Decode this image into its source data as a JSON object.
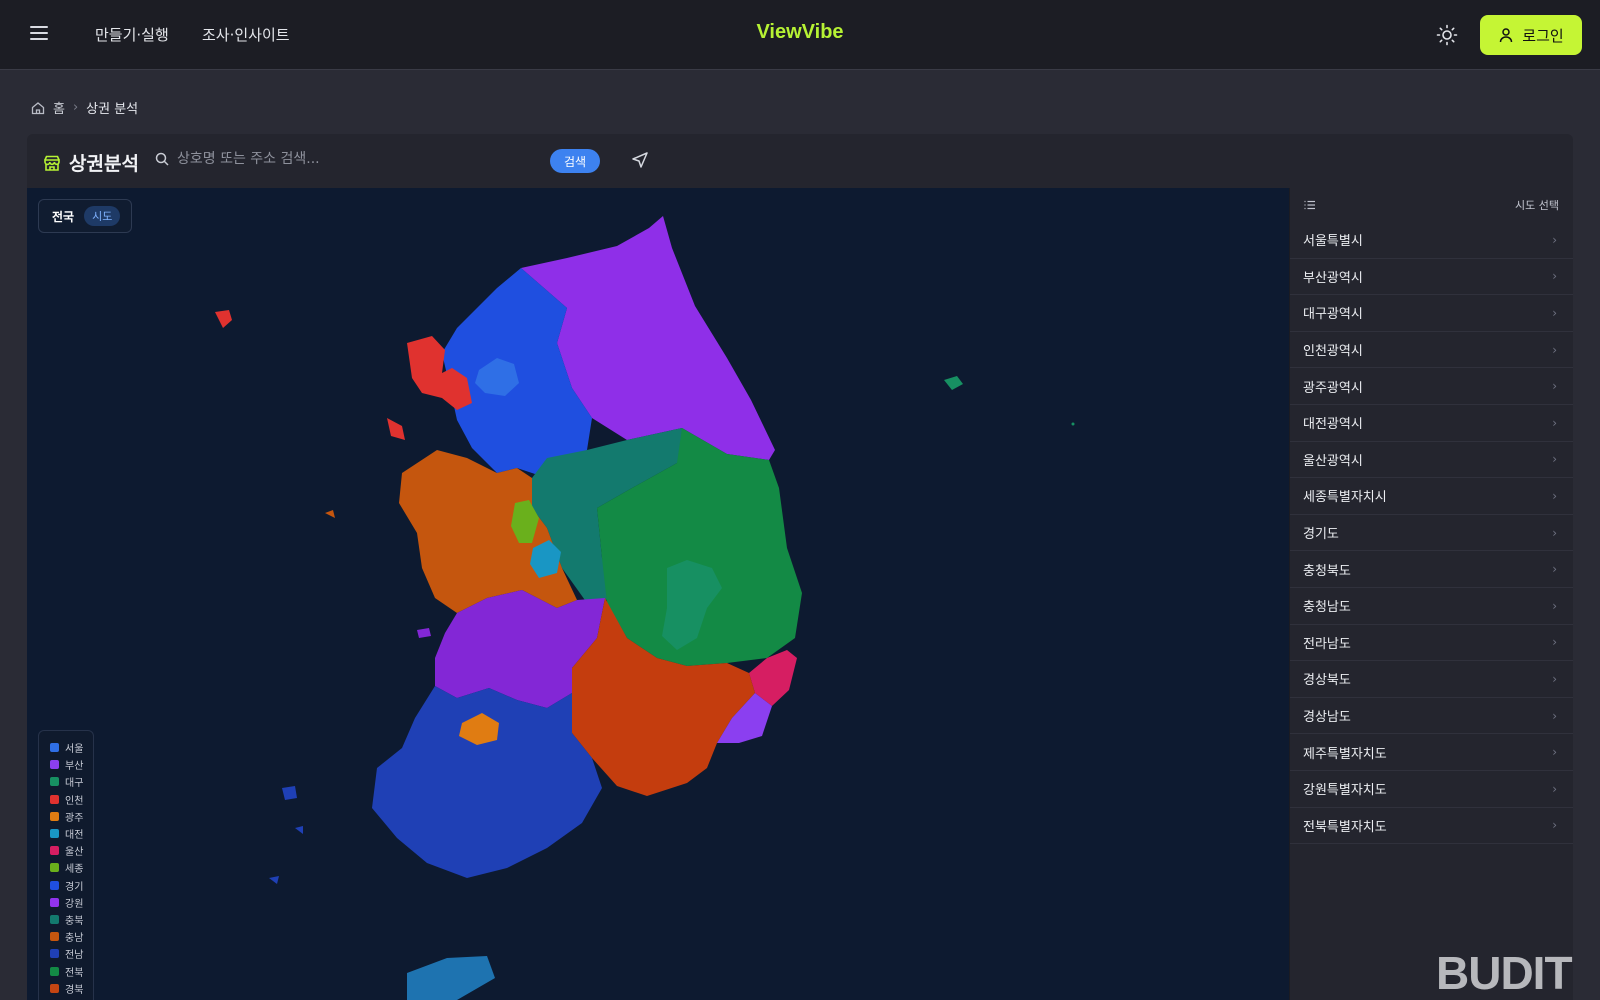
{
  "nav": {
    "links": [
      "만들기·실행",
      "조사·인사이트"
    ],
    "brand": "ViewVibe",
    "login_label": "로그인"
  },
  "breadcrumb": {
    "home": "홈",
    "current": "상권 분석"
  },
  "header": {
    "title": "상권분석",
    "search_placeholder": "상호명 또는 주소 검색...",
    "search_button": "검색"
  },
  "map": {
    "scope_label": "전국",
    "scope_level": "시도",
    "legend": [
      {
        "label": "서울",
        "color": "#2f6fe6"
      },
      {
        "label": "부산",
        "color": "#8b3ff0"
      },
      {
        "label": "대구",
        "color": "#179062"
      },
      {
        "label": "인천",
        "color": "#e0322f"
      },
      {
        "label": "광주",
        "color": "#e07c12"
      },
      {
        "label": "대전",
        "color": "#1996c4"
      },
      {
        "label": "울산",
        "color": "#d61e62"
      },
      {
        "label": "세종",
        "color": "#6ab01c"
      },
      {
        "label": "경기",
        "color": "#1f4fe0"
      },
      {
        "label": "강원",
        "color": "#9133ee"
      },
      {
        "label": "충북",
        "color": "#137a6e"
      },
      {
        "label": "충남",
        "color": "#c5560e"
      },
      {
        "label": "전남",
        "color": "#1f40b5"
      },
      {
        "label": "전북",
        "color": "#138a45"
      },
      {
        "label": "경북",
        "color": "#c44512"
      }
    ]
  },
  "sidebar": {
    "title": "시도 선택",
    "regions": [
      "서울특별시",
      "부산광역시",
      "대구광역시",
      "인천광역시",
      "광주광역시",
      "대전광역시",
      "울산광역시",
      "세종특별자치시",
      "경기도",
      "충청북도",
      "충청남도",
      "전라남도",
      "경상북도",
      "경상남도",
      "제주특별자치도",
      "강원특별자치도",
      "전북특별자치도"
    ]
  },
  "watermark": "BUDIT"
}
